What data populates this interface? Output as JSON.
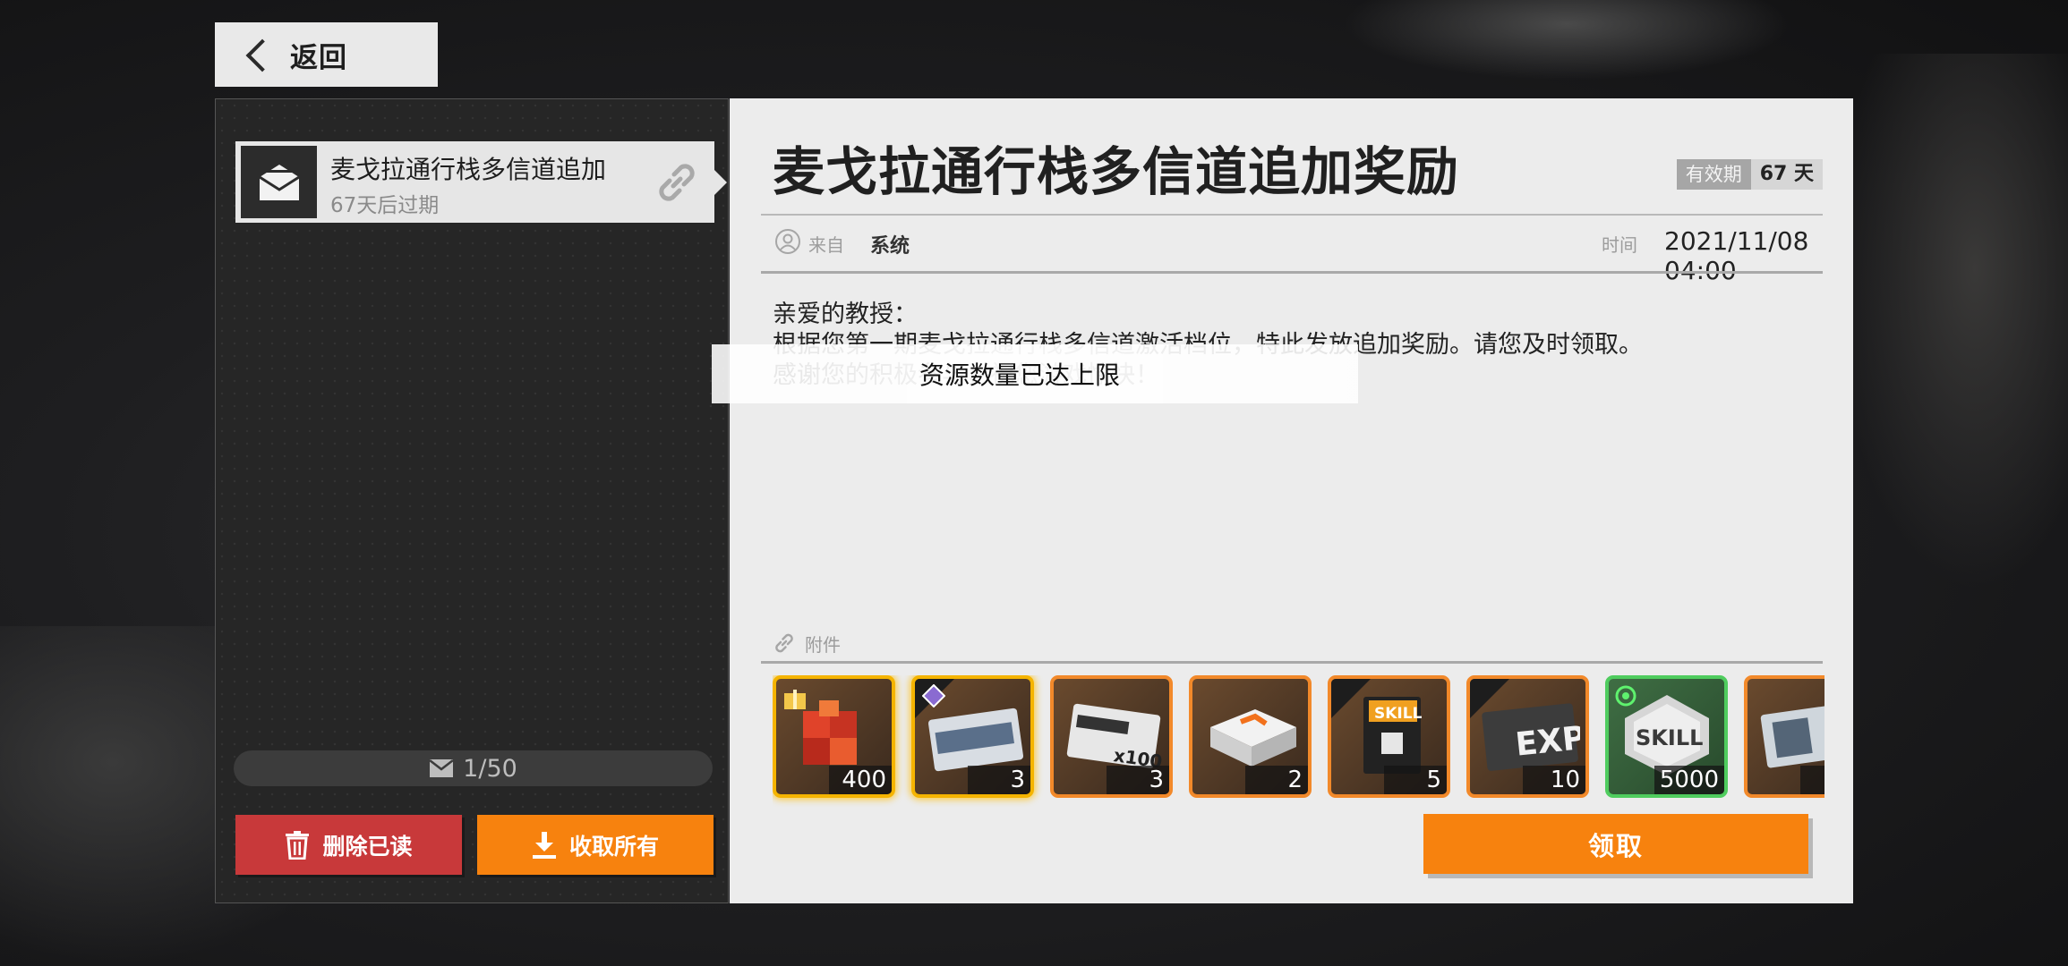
{
  "nav": {
    "back_label": "返回"
  },
  "mail_list": {
    "items": [
      {
        "title": "麦戈拉通行栈多信道追加",
        "expiry": "67天后过期"
      }
    ],
    "count": "1/50",
    "delete_read_label": "删除已读",
    "collect_all_label": "收取所有"
  },
  "mail": {
    "title": "麦戈拉通行栈多信道追加奖励",
    "validity_label": "有效期",
    "validity_value": "67 天",
    "from_label": "来自",
    "from_value": "系统",
    "time_label": "时间",
    "time_value": "2021/11/08 04:00",
    "body": [
      "亲爱的教授：",
      "根据您第一期麦戈拉通行栈多信道激活档位，特此发放追加奖励。请您及时领取。",
      "感谢您的积极参与，祝您游戏愉快！"
    ],
    "toast": "资源数量已达上限",
    "attachments_label": "附件",
    "attachments": [
      {
        "icon": "red-cube-item-icon",
        "qty": "400"
      },
      {
        "icon": "retrieval-instruction-icon",
        "qty": "3"
      },
      {
        "icon": "key-card-x100-icon",
        "qty": "3"
      },
      {
        "icon": "supply-crate-icon",
        "qty": "2"
      },
      {
        "icon": "skill-book-icon",
        "qty": "5"
      },
      {
        "icon": "exp-card-icon",
        "qty": "10"
      },
      {
        "icon": "skill-chip-icon",
        "qty": "5000"
      },
      {
        "icon": "partial-item-icon",
        "qty": ""
      }
    ],
    "claim_label": "领取"
  },
  "colors": {
    "accent_orange": "#f7820e",
    "delete_red": "#c8393a",
    "panel_dark": "#262626",
    "panel_light": "#ececec"
  }
}
